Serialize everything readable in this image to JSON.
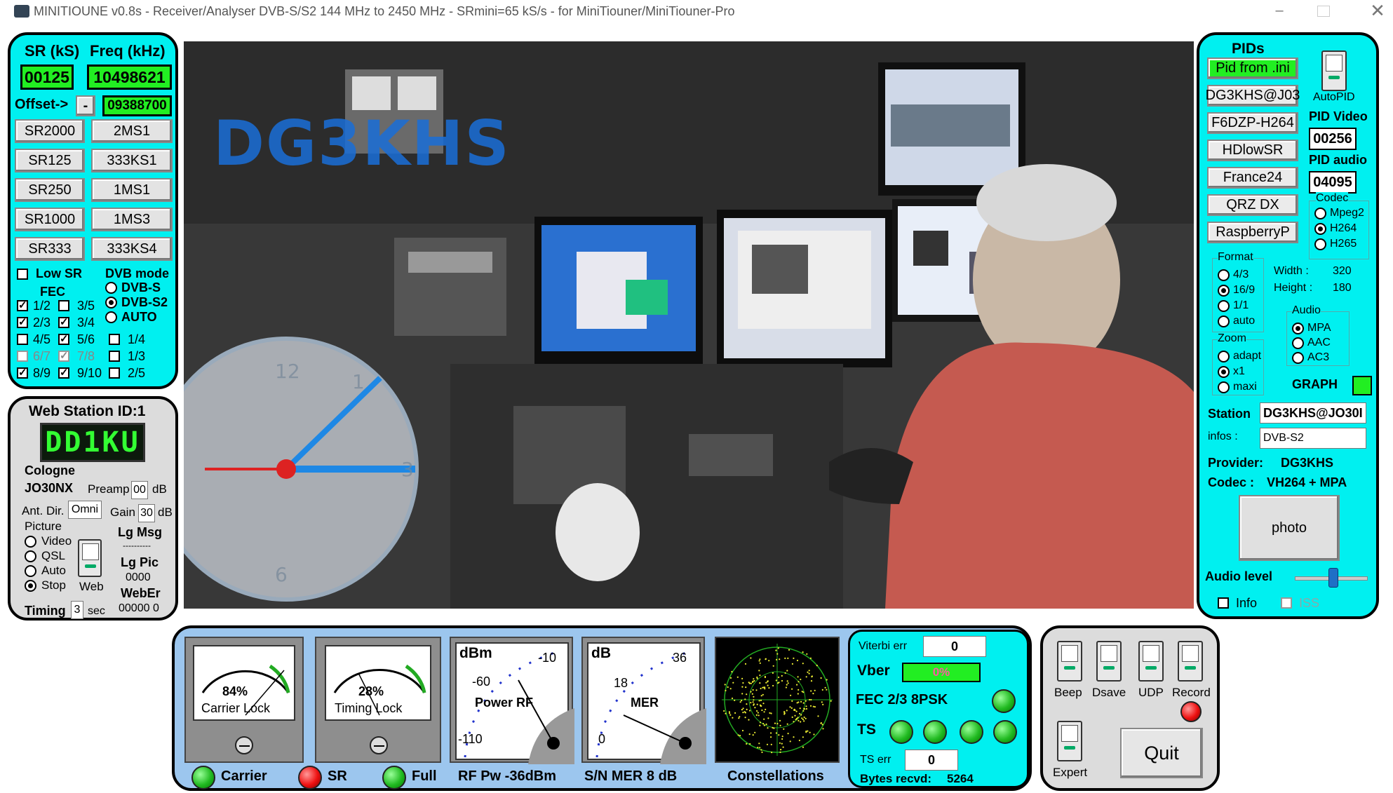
{
  "window": {
    "title": "MINITIOUNE v0.8s - Receiver/Analyser DVB-S/S2 144 MHz to 2450 MHz - SRmini=65 kS/s - for MiniTiouner/MiniTiouner-Pro",
    "controls": [
      "minimize",
      "maximize",
      "close"
    ]
  },
  "tuning": {
    "sr_label": "SR (kS)",
    "freq_label": "Freq (kHz)",
    "sr_value": "00125",
    "freq_value": "10498621",
    "offset_label": "Offset->",
    "offset_sign": "-",
    "offset_value": "09388700",
    "sr_buttons": [
      "SR2000",
      "SR125",
      "SR250",
      "SR1000",
      "SR333"
    ],
    "preset_buttons": [
      "2MS1",
      "333KS1",
      "1MS1",
      "1MS3",
      "333KS4"
    ],
    "low_sr_label": "Low SR",
    "dvb_mode_label": "DVB mode",
    "fec_label": "FEC",
    "dvb_modes": [
      "DVB-S",
      "DVB-S2",
      "AUTO"
    ],
    "fec_col1": [
      "1/2",
      "2/3",
      "4/5",
      "6/7",
      "8/9"
    ],
    "fec_col2": [
      "3/5",
      "3/4",
      "5/6",
      "7/8",
      "9/10"
    ],
    "fec_col3": [
      "1/4",
      "1/3",
      "2/5"
    ]
  },
  "web": {
    "title": "Web Station ID:1",
    "lcd": "DD1KU",
    "city": "Cologne",
    "locator": "JO30NX",
    "preamp_label": "Preamp",
    "preamp_value": "00",
    "db": "dB",
    "antdir_label": "Ant. Dir.",
    "antdir_value": "Omni",
    "gain_label": "Gain",
    "gain_value": "30",
    "picture_label": "Picture",
    "picture_options": [
      "Video",
      "QSL",
      "Auto",
      "Stop"
    ],
    "web_label": "Web",
    "lgmsg_label": "Lg Msg",
    "lgmsg_value": "----------",
    "lgpic_label": "Lg Pic",
    "lgpic_value": "0000",
    "weber_label": "WebEr",
    "weber_value": "00000  0",
    "timing_label": "Timing",
    "timing_value": "3",
    "sec": "sec"
  },
  "video": {
    "overlay_callsign": "DG3KHS"
  },
  "pids": {
    "title": "PIDs",
    "buttons": [
      "Pid from .ini",
      "DG3KHS@J03",
      "F6DZP-H264",
      "HDlowSR",
      "France24",
      "QRZ DX",
      "RaspberryP"
    ],
    "autopid_label": "AutoPID",
    "pid_video_label": "PID Video",
    "pid_video": "00256",
    "pid_audio_label": "PID audio",
    "pid_audio": "04095",
    "codec_label": "Codec",
    "codec_options": [
      "Mpeg2",
      "H264",
      "H265"
    ],
    "format_label": "Format",
    "format_options": [
      "4/3",
      "16/9",
      "1/1",
      "auto"
    ],
    "width_label": "Width :",
    "width_value": "320",
    "height_label": "Height :",
    "height_value": "180",
    "zoom_label": "Zoom",
    "zoom_options": [
      "adapt",
      "x1",
      "maxi"
    ],
    "audio_label": "Audio",
    "audio_options": [
      "MPA",
      "AAC",
      "AC3"
    ],
    "graph_label": "GRAPH",
    "station_label": "Station",
    "station_value": "DG3KHS@JO30I",
    "infos_label": "infos :",
    "infos_value": "DVB-S2",
    "provider_label": "Provider:",
    "provider_value": "DG3KHS",
    "codec_info_label": "Codec :",
    "codec_info_value": "VH264 + MPA",
    "photo_label": "photo",
    "audio_level_label": "Audio level",
    "audio_level": 0.55,
    "info_label": "Info",
    "iss_label": "ISS"
  },
  "meters": {
    "carrier_pct": "84%",
    "carrier_label": "Carrier Lock",
    "timing_pct": "28%",
    "timing_label": "Timing Lock",
    "rf_unit": "dBm",
    "rf_ticks": [
      "-10",
      "-60",
      "-110"
    ],
    "rf_label": "Power RF",
    "mer_unit": "dB",
    "mer_ticks": [
      "36",
      "18",
      "0"
    ],
    "mer_label": "MER",
    "carrier_led": "Carrier",
    "sr_led": "SR",
    "full_led": "Full",
    "rf_readout": "RF Pw  -36dBm",
    "mer_readout": "S/N MER   8 dB",
    "constellation_label": "Constellations"
  },
  "status": {
    "viterbi_label": "Viterbi err",
    "viterbi_value": "0",
    "vber_label": "Vber",
    "vber_value": "0%",
    "fec_label": "FEC 2/3 8PSK",
    "ts_label": "TS",
    "ts_err_label": "TS err",
    "ts_err_value": "0",
    "bytes_label": "Bytes recvd:",
    "bytes_value": "5264"
  },
  "controls": {
    "beep": "Beep",
    "dsave": "Dsave",
    "udp": "UDP",
    "record": "Record",
    "expert": "Expert",
    "quit": "Quit"
  },
  "colors": {
    "panel": "#00f0f0",
    "lcd_green": "#22ee22",
    "led_green": "#22bb22",
    "led_red": "#ee1111"
  }
}
